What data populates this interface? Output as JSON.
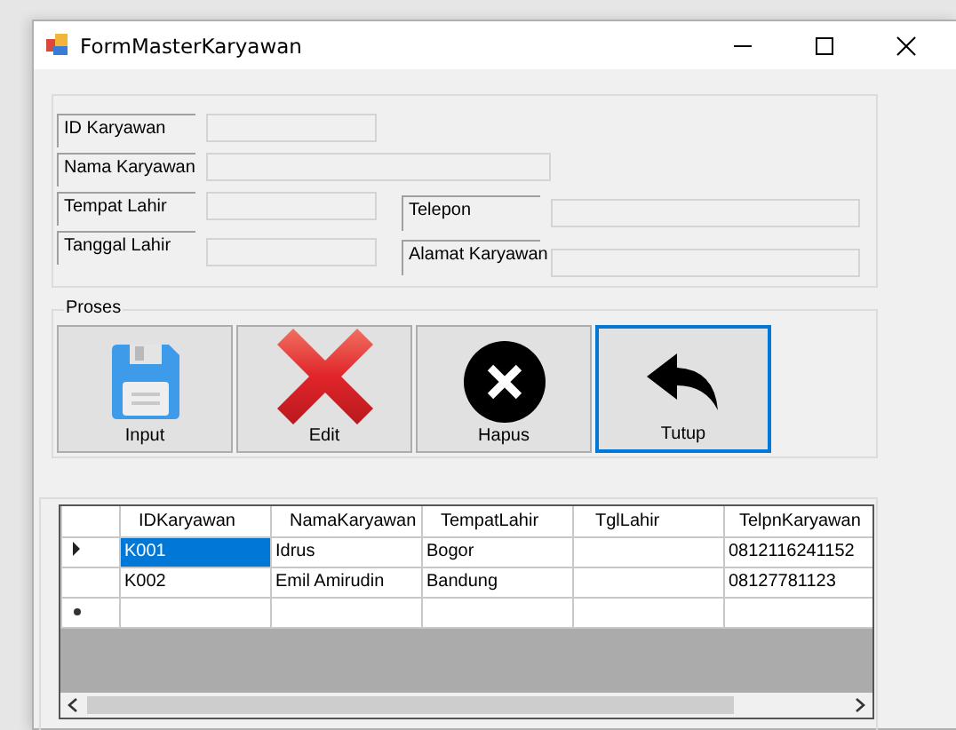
{
  "window": {
    "title": "FormMasterKaryawan"
  },
  "form_rows": [
    {
      "fields": [
        {
          "label": "ID Karyawan",
          "kind": "short"
        }
      ]
    },
    {
      "fields": [
        {
          "label": "Nama Karyawan",
          "kind": "long"
        }
      ]
    },
    {
      "fields": [
        {
          "label": "Tempat Lahir",
          "kind": "short"
        },
        {
          "label": "Telepon",
          "kind": "wide"
        }
      ]
    },
    {
      "fields": [
        {
          "label": "Tanggal Lahir",
          "kind": "short"
        },
        {
          "label": "Alamat Karyawan",
          "kind": "wide"
        }
      ]
    }
  ],
  "process": {
    "title": "Proses",
    "buttons": [
      {
        "label": "Input",
        "kind": "save",
        "selected": false
      },
      {
        "label": "Edit",
        "kind": "delete",
        "selected": false
      },
      {
        "label": "Hapus",
        "kind": "close",
        "selected": false
      },
      {
        "label": "Tutup",
        "kind": "back",
        "selected": true
      }
    ]
  },
  "table": {
    "columns": [
      "IDKaryawan",
      "NamaKaryawan",
      "TempatLahir",
      "TglLahir",
      "TelpnKaryawan"
    ],
    "rows": [
      {
        "kind": "current",
        "cells": [
          {
            "text": "K001",
            "selected": true
          },
          {
            "text": "Idrus",
            "selected": false
          },
          {
            "text": "Bogor",
            "selected": false
          },
          {
            "selected": false
          },
          {
            "text": "0812116241152",
            "selected": false
          }
        ]
      },
      {
        "kind": "data",
        "cells": [
          {
            "text": "K002",
            "selected": false
          },
          {
            "text": "Emil Amirudin",
            "selected": false
          },
          {
            "text": "Bandung",
            "selected": false
          },
          {
            "selected": false
          },
          {
            "text": "08127781123",
            "selected": false
          }
        ]
      },
      {
        "kind": "new",
        "cells": [
          {
            "selected": false
          },
          {
            "selected": false
          },
          {
            "selected": false
          },
          {
            "selected": false
          },
          {
            "selected": false
          }
        ]
      }
    ]
  }
}
